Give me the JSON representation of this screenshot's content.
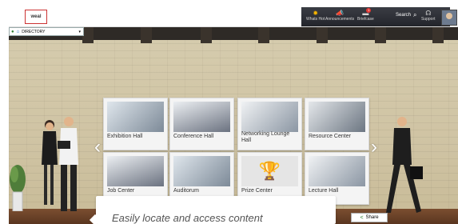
{
  "header": {
    "logo_text": "weal",
    "items": [
      {
        "label": "Whats Hot"
      },
      {
        "label": "Announcements"
      },
      {
        "label": "Briefcase",
        "badge": "1"
      }
    ],
    "search_label": "Search",
    "support_label": "Support"
  },
  "directory": {
    "label": "DIRECTORY"
  },
  "tiles": [
    {
      "label": "Exhibition Hall"
    },
    {
      "label": "Conference Hall"
    },
    {
      "label": "Networking Lounge Hall"
    },
    {
      "label": "Resource Center"
    },
    {
      "label": "Job Center"
    },
    {
      "label": "Auditorum"
    },
    {
      "label": "Prize Center"
    },
    {
      "label": "Lecture Hall"
    }
  ],
  "caption": {
    "text": "Easily locate and access content"
  },
  "share": {
    "label": "Share"
  },
  "icons": {
    "whats_hot": "sun-icon",
    "announcements": "megaphone-icon",
    "briefcase": "briefcase-icon",
    "search": "search-icon",
    "support": "headset-icon"
  }
}
